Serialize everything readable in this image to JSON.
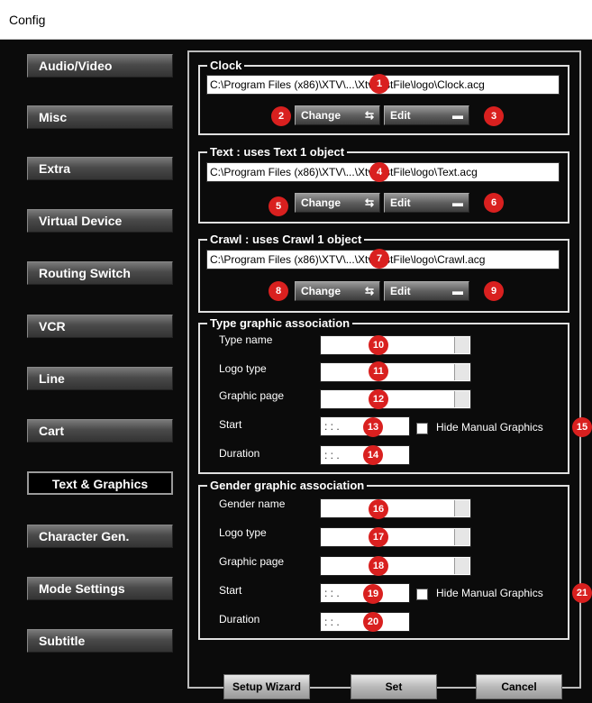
{
  "window": {
    "title": "Config"
  },
  "nav": {
    "items": [
      {
        "label": "Audio/Video"
      },
      {
        "label": "Misc"
      },
      {
        "label": "Extra"
      },
      {
        "label": "Virtual Device"
      },
      {
        "label": "Routing Switch"
      },
      {
        "label": "VCR"
      },
      {
        "label": "Line"
      },
      {
        "label": "Cart"
      },
      {
        "label": "Text & Graphics",
        "active": true
      },
      {
        "label": "Character Gen."
      },
      {
        "label": "Mode Settings"
      },
      {
        "label": "Subtitle"
      }
    ]
  },
  "clock": {
    "title": "Clock",
    "path": "C:\\Program Files (x86)\\XTV\\...\\XtvTestFile\\logo\\Clock.acg",
    "change_label": "Change",
    "edit_label": "Edit"
  },
  "text": {
    "title": "Text : uses Text 1 object",
    "path": "C:\\Program Files (x86)\\XTV\\...\\XtvTestFile\\logo\\Text.acg",
    "change_label": "Change",
    "edit_label": "Edit"
  },
  "crawl": {
    "title": "Crawl : uses Crawl 1 object",
    "path": "C:\\Program Files (x86)\\XTV\\...\\XtvTestFile\\logo\\Crawl.acg",
    "change_label": "Change",
    "edit_label": "Edit"
  },
  "type_assoc": {
    "title": "Type graphic association",
    "type_name_label": "Type name",
    "logo_type_label": "Logo type",
    "graphic_page_label": "Graphic page",
    "start_label": "Start",
    "start_value": ": : .",
    "duration_label": "Duration",
    "duration_value": ": : .",
    "hide_manual_label": "Hide Manual Graphics"
  },
  "gender_assoc": {
    "title": "Gender graphic association",
    "gender_name_label": "Gender name",
    "logo_type_label": "Logo type",
    "graphic_page_label": "Graphic page",
    "start_label": "Start",
    "start_value": ": : .",
    "duration_label": "Duration",
    "duration_value": ": : .",
    "hide_manual_label": "Hide Manual Graphics"
  },
  "badges": [
    "1",
    "2",
    "3",
    "4",
    "5",
    "6",
    "7",
    "8",
    "9",
    "10",
    "11",
    "12",
    "13",
    "14",
    "15",
    "16",
    "17",
    "18",
    "19",
    "20",
    "21"
  ],
  "footer": {
    "setup_wizard_label": "Setup Wizard",
    "set_label": "Set",
    "cancel_label": "Cancel"
  },
  "colors": {
    "badge": "#d9201f",
    "background": "#0b0b0b"
  }
}
